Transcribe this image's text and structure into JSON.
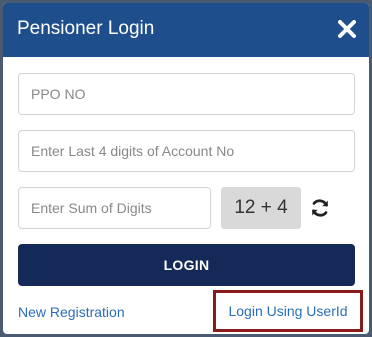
{
  "modal": {
    "title": "Pensioner Login",
    "close_icon": "close-icon"
  },
  "form": {
    "ppo_placeholder": "PPO NO",
    "account_placeholder": "Enter Last 4 digits of Account No",
    "sum_placeholder": "Enter Sum of Digits",
    "captcha_text": "12 + 4",
    "refresh_icon": "refresh-icon",
    "login_label": "LOGIN"
  },
  "links": {
    "new_registration": "New Registration",
    "login_userid": "Login Using UserId"
  },
  "colors": {
    "header": "#1e4f8c",
    "login_button": "#142958",
    "link": "#2a6ebb",
    "highlight_border": "#8b1a1a",
    "captcha_bg": "#d9d9d9"
  }
}
